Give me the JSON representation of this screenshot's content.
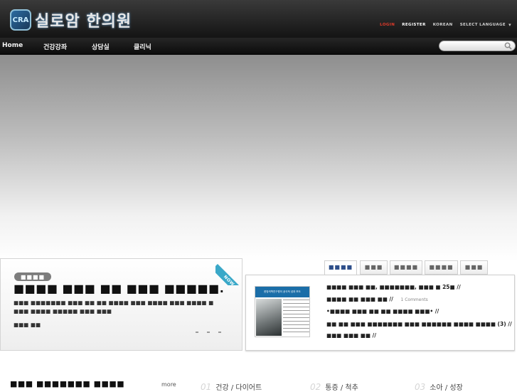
{
  "header": {
    "logo_mark": "CRA",
    "logo_text": "실로암 한의원",
    "topnav": {
      "login": "LOGIN",
      "register": "REGISTER",
      "korean": "KOREAN",
      "select_language": "SELECT LANGUAGE"
    }
  },
  "nav": {
    "items": [
      "Home",
      "건강강좌",
      "상담실",
      "클리닉"
    ],
    "search_placeholder": ""
  },
  "news": {
    "pill": "■■■■",
    "title": "■■■■ ■■■ ■■ ■■■ ■■■■■.",
    "description": "■■■ ■■■■■■■ ■■■ ■■ ■■ ■■■■ ■■■ ■■■■ ■■■ ■■■■ ■ ■■■ ■■■■ ■■■■■ ■■■ ■■■",
    "date": "■■■ ■■",
    "ribbon": "NOW"
  },
  "tabs": [
    "■■■■",
    "■■■",
    "■■■■",
    "■■■■",
    "■■■"
  ],
  "posts": [
    {
      "text": "■■■■ ■■■ ■■, ■■■■■■■, ■■■ ■ 25■ //"
    },
    {
      "text": "■■■■ ■■ ■■■ ■■ //",
      "comments": "1 Comments"
    },
    {
      "text": "•■■■■ ■■■ ■■ ■■ ■■■■ ■■■• //"
    },
    {
      "text": "■■ ■■ ■■■ ■■■■■■■ ■■■ ■■■■■■ ■■■■ ■■■■ (3) //"
    },
    {
      "text": "■■■ ■■■ ■■ //"
    }
  ],
  "thumbnail": {
    "headline": "한방의학연구원이 공식적 성과 보도"
  },
  "bottom": {
    "title": "■■■ ■■■■■■■ ■■■■",
    "more": "more",
    "items": [
      {
        "num": "01",
        "label": "건강 / 다이어트"
      },
      {
        "num": "02",
        "label": "통증 / 척추"
      },
      {
        "num": "03",
        "label": "소아 / 성장"
      }
    ]
  },
  "colors": {
    "login_accent": "#e23a2a",
    "tab_active": "#2e4f8a",
    "ribbon": "#3aa8c8"
  }
}
